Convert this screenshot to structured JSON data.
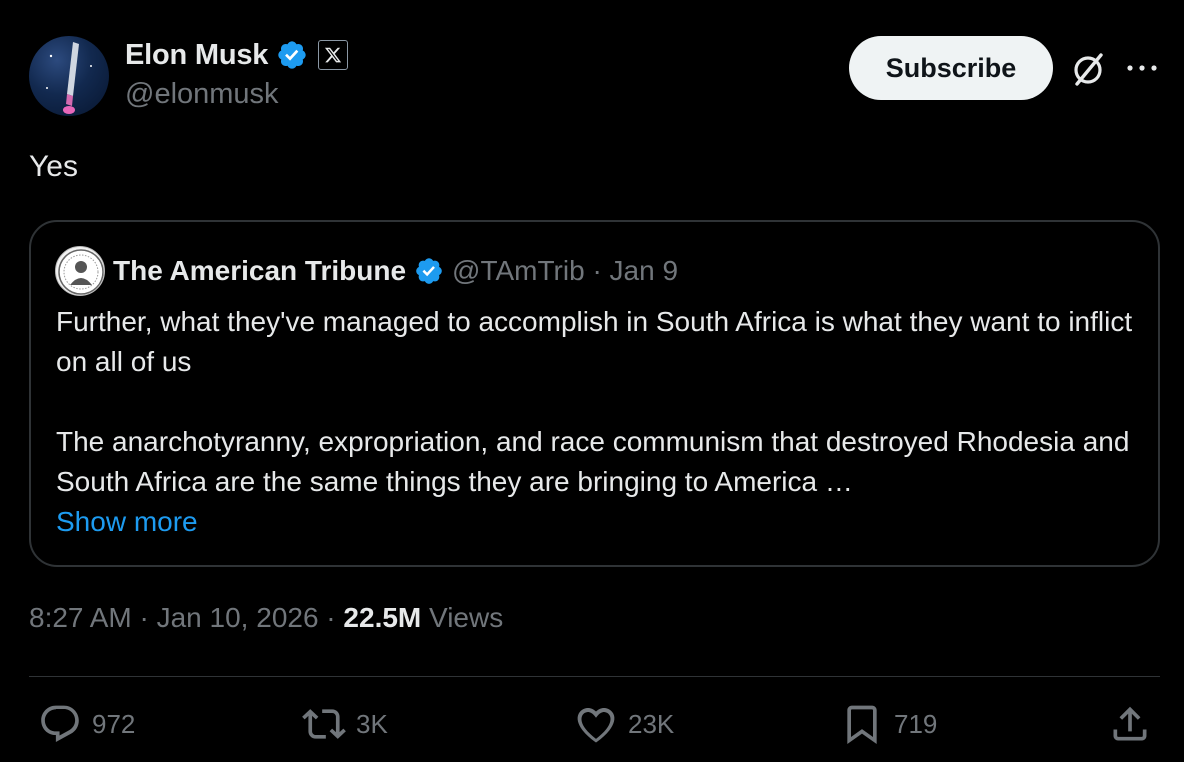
{
  "author": {
    "name": "Elon Musk",
    "handle": "@elonmusk"
  },
  "header": {
    "subscribe_label": "Subscribe"
  },
  "tweet": {
    "text": "Yes",
    "timestamp": "8:27 AM · Jan 10, 2026 · ",
    "views_count": "22.5M",
    "views_label": " Views"
  },
  "quoted": {
    "name": "The American Tribune",
    "meta": "@TAmTrib · Jan 9",
    "paragraph1": "Further, what they've managed to accomplish in South Africa is what they want to inflict on all of us",
    "paragraph2": "The anarchotyranny, expropriation, and race communism that destroyed Rhodesia and South Africa are the same things they are bringing to America …",
    "show_more": "Show more"
  },
  "actions": {
    "replies": "972",
    "reposts": "3K",
    "likes": "23K",
    "bookmarks": "719"
  },
  "colors": {
    "background": "#000000",
    "text": "#e7e9ea",
    "muted": "#71767b",
    "accent": "#1d9bf0",
    "border": "#2f3336"
  },
  "icons": [
    "verified-badge-icon",
    "x-affiliate-icon",
    "grok-icon",
    "more-icon",
    "reply-icon",
    "repost-icon",
    "like-icon",
    "bookmark-icon",
    "share-icon"
  ]
}
